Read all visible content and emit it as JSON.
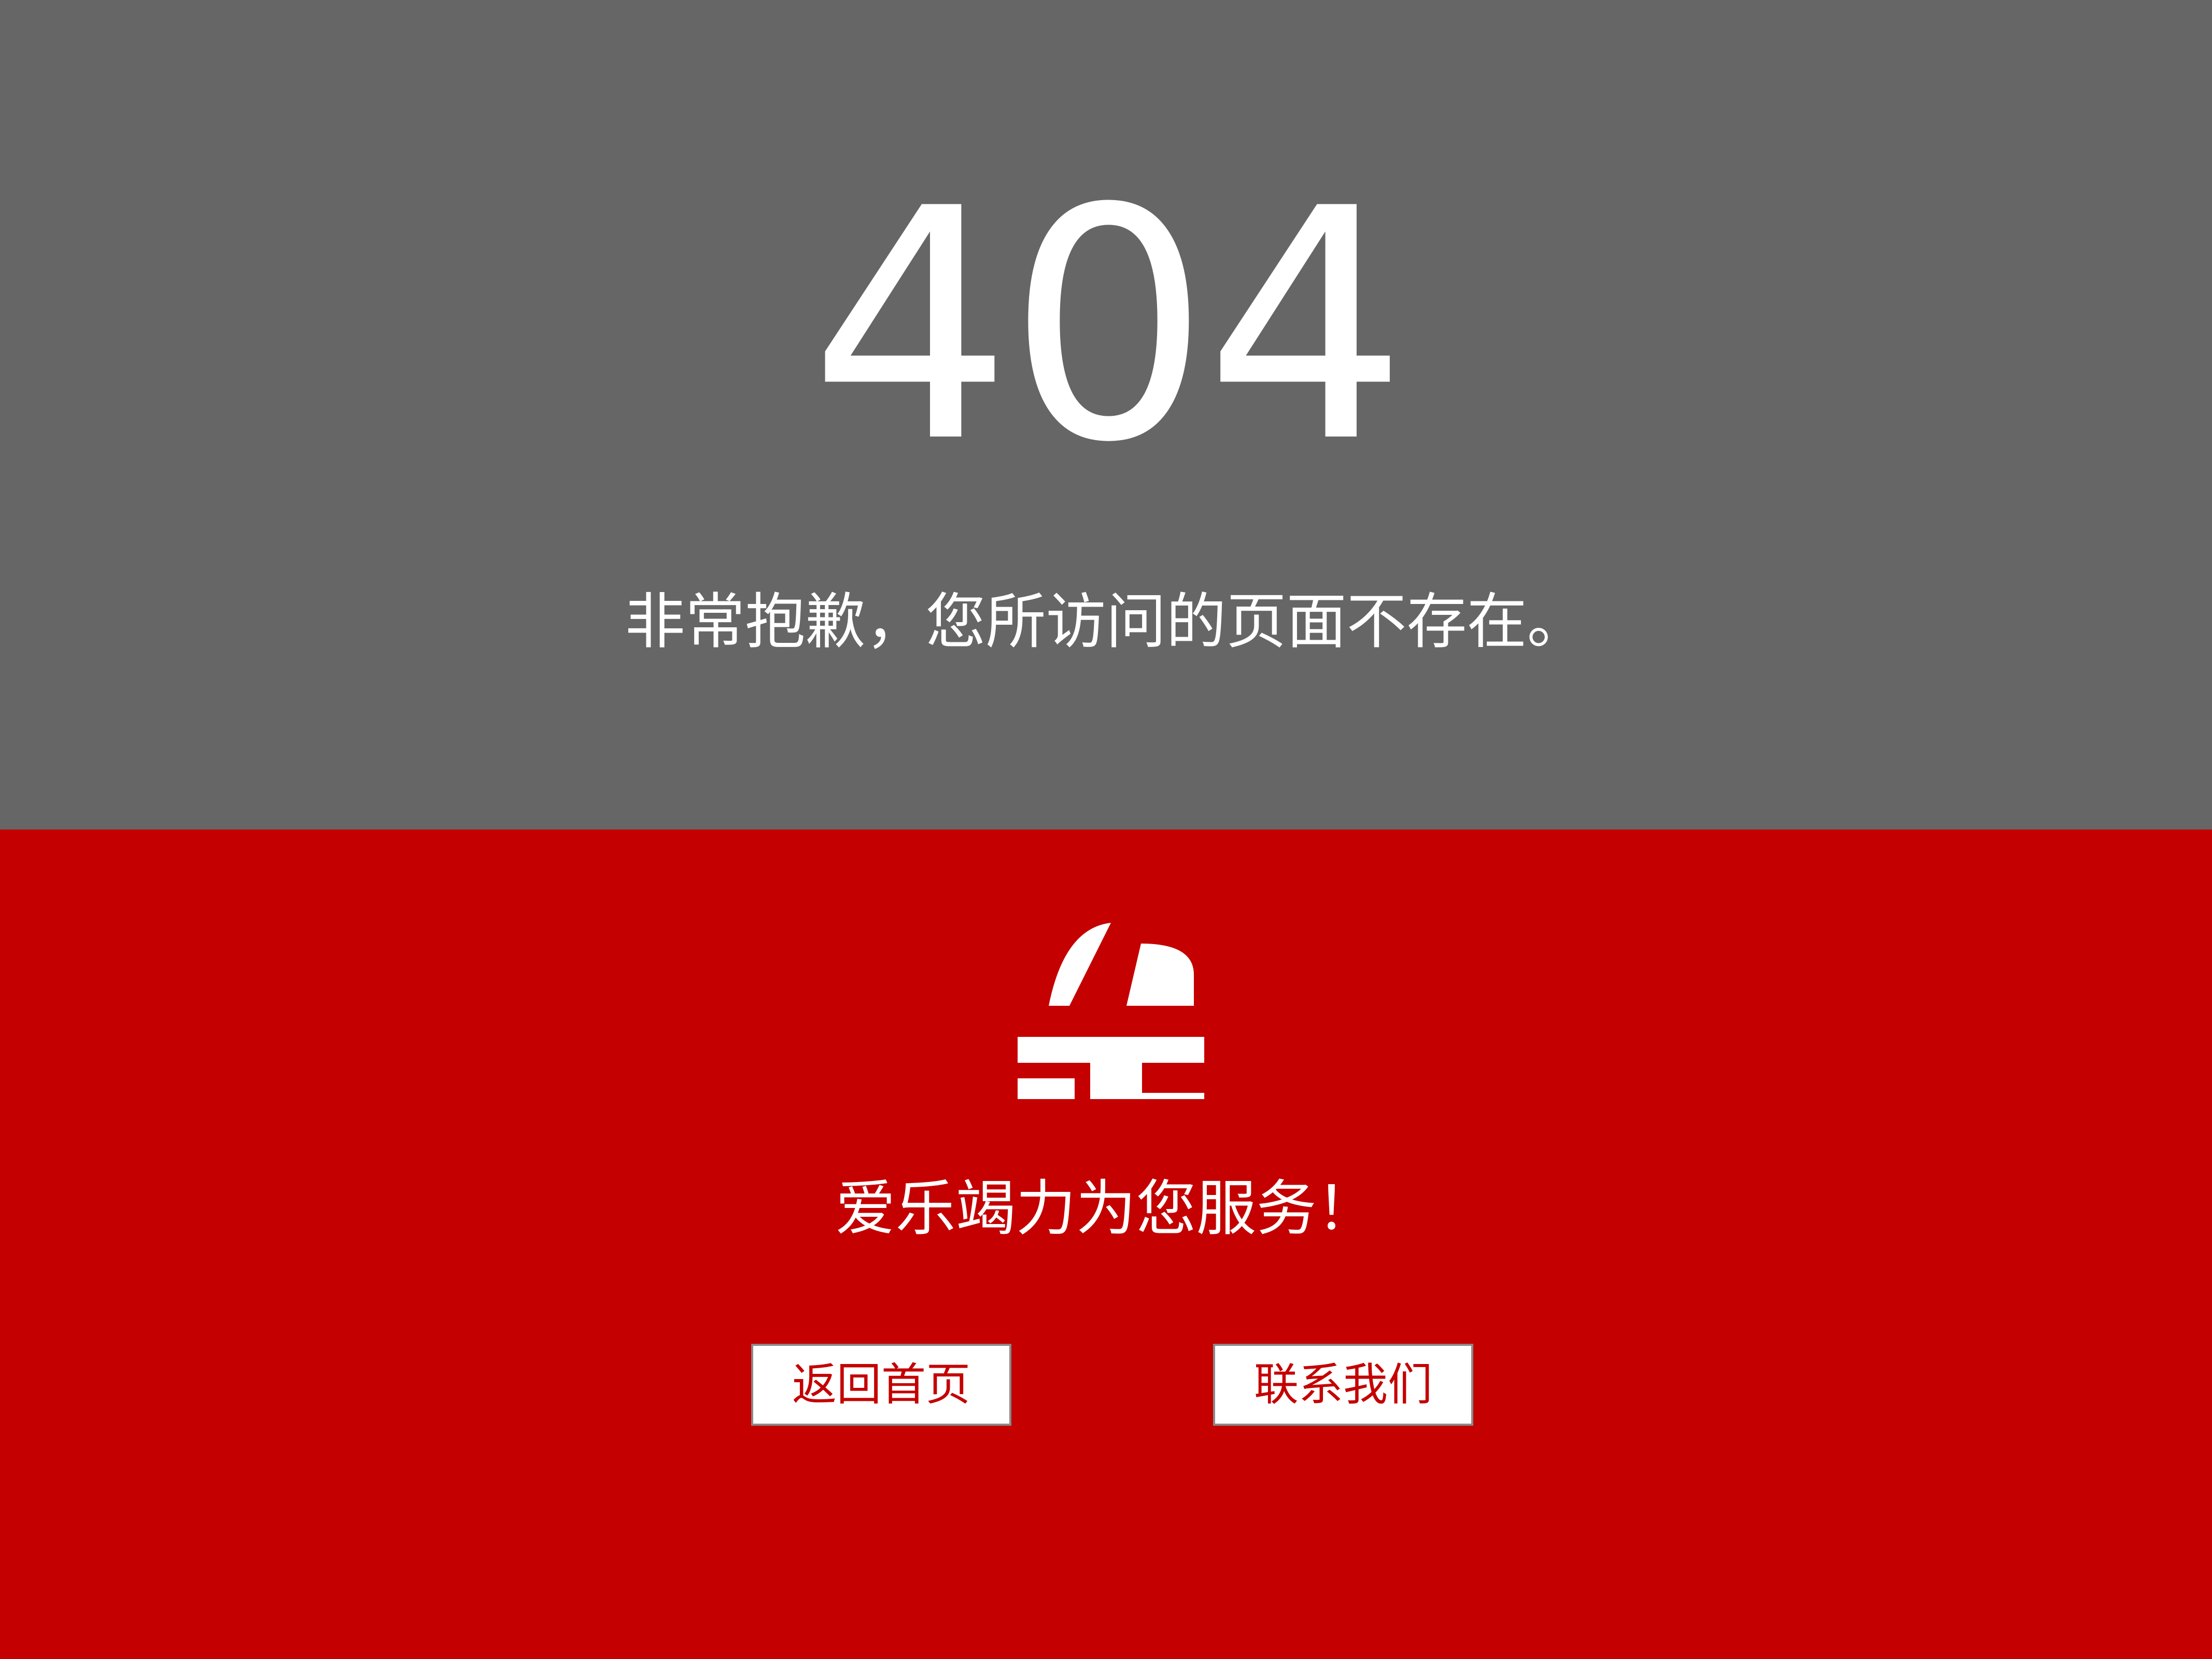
{
  "colors": {
    "top_background": "#666666",
    "bottom_background": "#c40000",
    "text": "#ffffff",
    "button_text": "#c40000"
  },
  "error": {
    "code": "404",
    "message": "非常抱歉，您所访问的页面不存在。"
  },
  "brand": {
    "logo_icon": "aile-logo-icon",
    "slogan": "爱乐竭力为您服务！"
  },
  "buttons": {
    "home_label": "返回首页",
    "contact_label": "联系我们"
  }
}
